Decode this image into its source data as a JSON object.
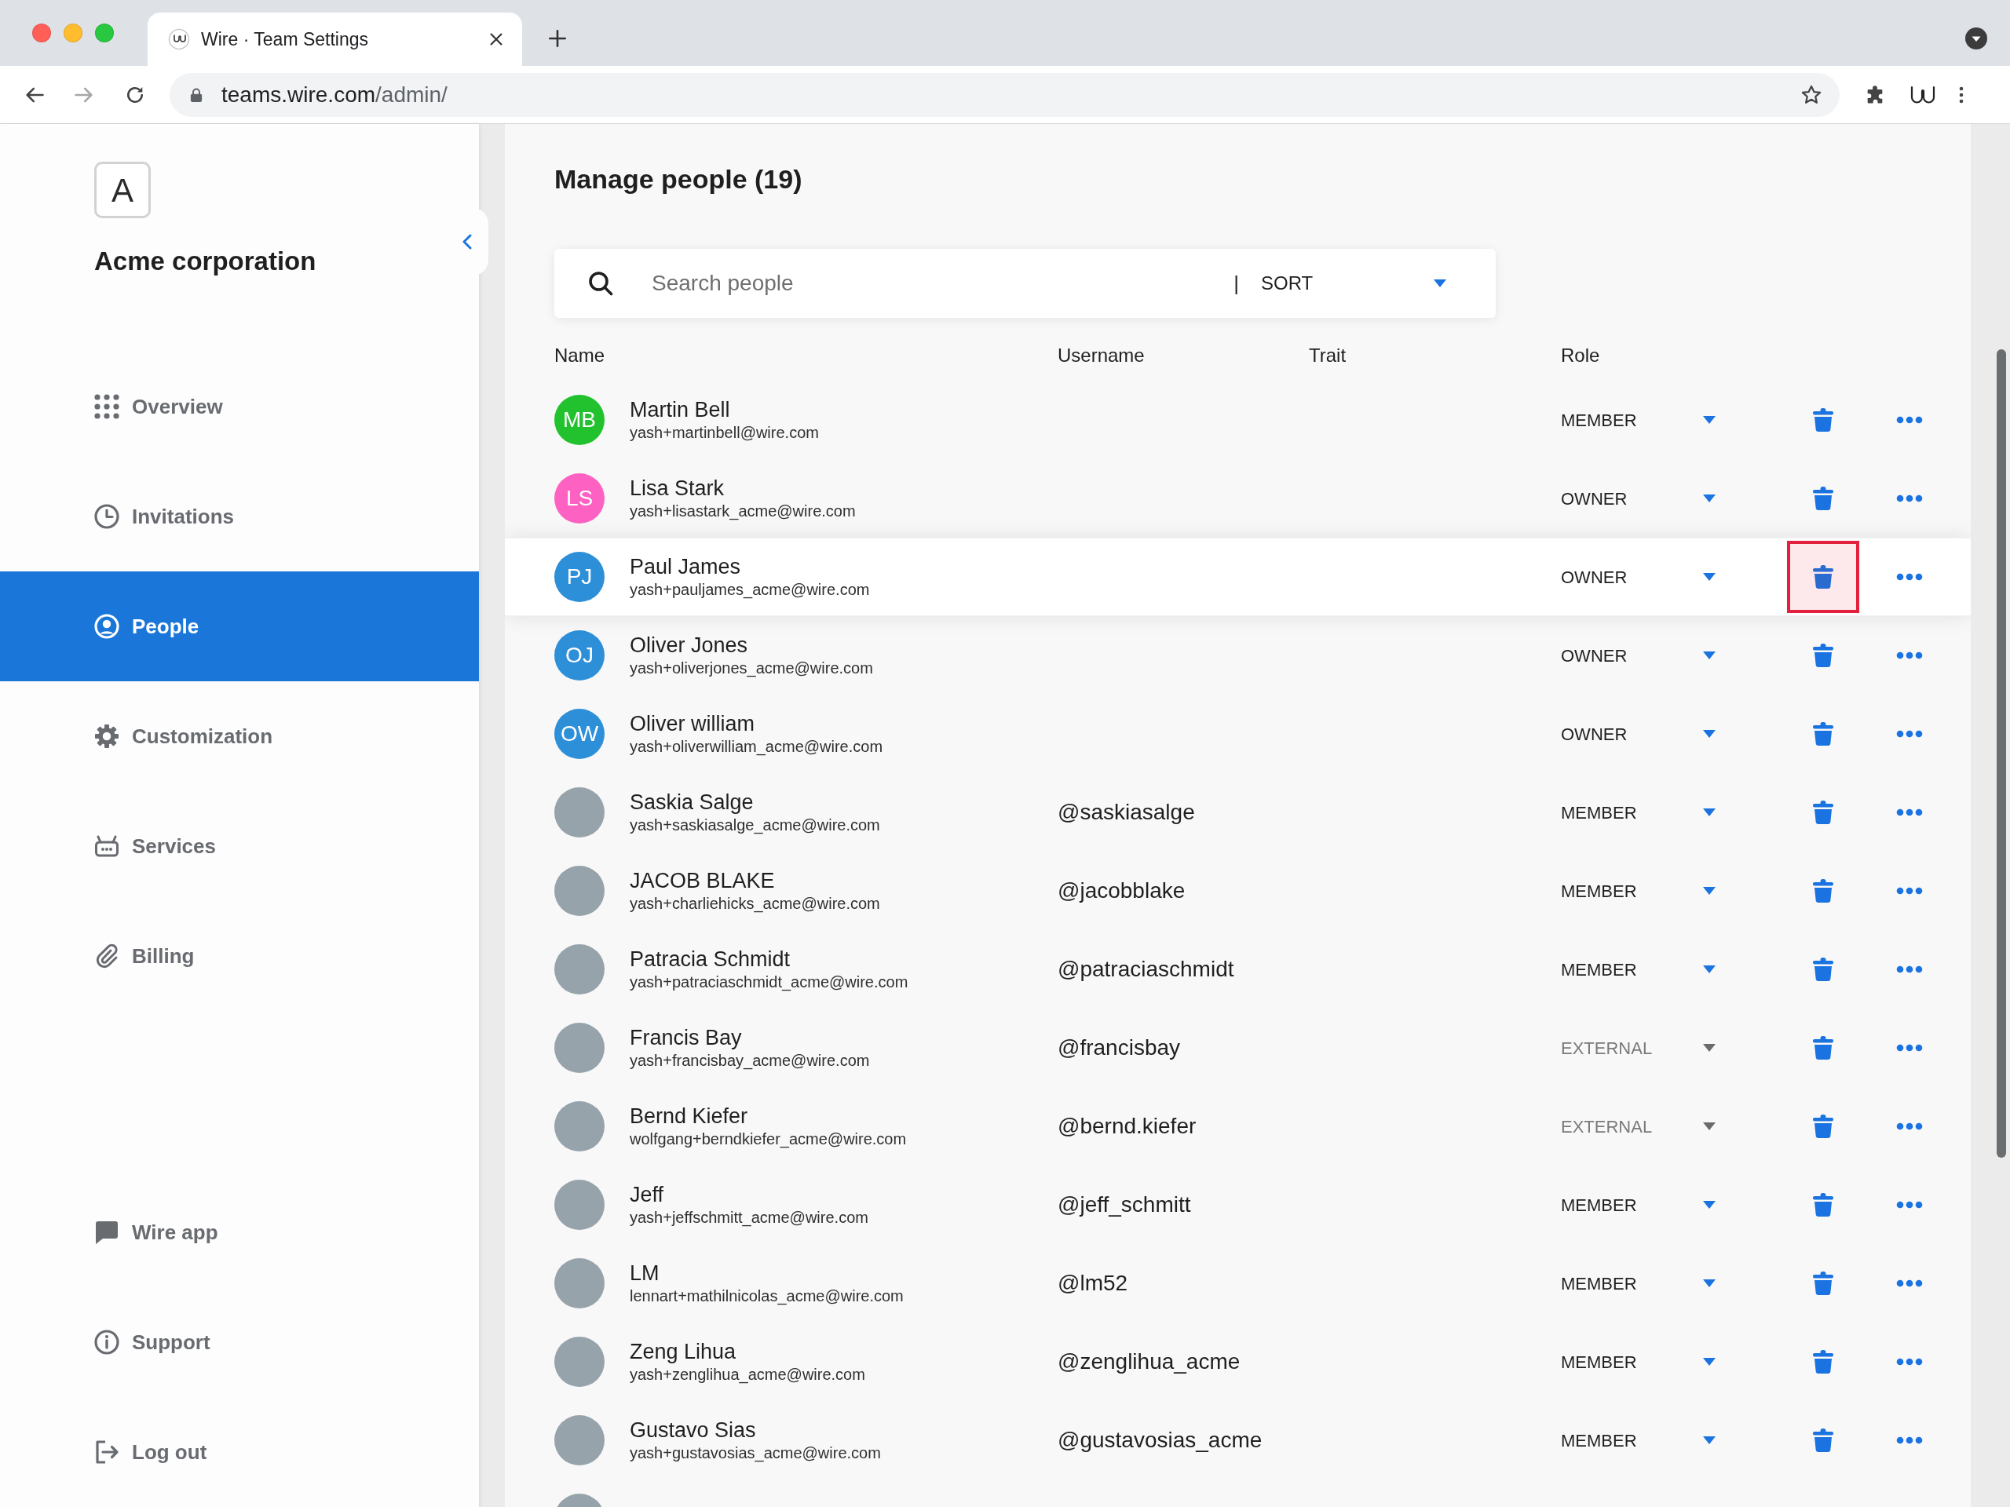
{
  "browser": {
    "tab": {
      "title": "Wire · Team Settings"
    },
    "address": {
      "host": "teams.wire.com",
      "path": "/admin/"
    }
  },
  "sidebar": {
    "logo_letter": "A",
    "team_name": "Acme corporation",
    "items": [
      {
        "label": "Overview",
        "selected": false
      },
      {
        "label": "Invitations",
        "selected": false
      },
      {
        "label": "People",
        "selected": true
      },
      {
        "label": "Customization",
        "selected": false
      },
      {
        "label": "Services",
        "selected": false
      },
      {
        "label": "Billing",
        "selected": false
      }
    ],
    "footer_items": [
      {
        "label": "Wire app"
      },
      {
        "label": "Support"
      },
      {
        "label": "Log out"
      }
    ]
  },
  "main": {
    "title": "Manage people (19)",
    "search": {
      "placeholder": "Search people",
      "separator": "|",
      "sort_label": "SORT"
    },
    "table": {
      "columns": [
        "Name",
        "Username",
        "Trait",
        "Role"
      ],
      "rows": [
        {
          "avatar": {
            "kind": "initials",
            "initials": "MB",
            "color": "#22c22e"
          },
          "name": "Martin Bell",
          "email": "yash+martinbell@wire.com",
          "role": "MEMBER",
          "role_disabled": false,
          "hovered": false,
          "delete_marked": false
        },
        {
          "avatar": {
            "kind": "initials",
            "initials": "LS",
            "color": "#fd62c3"
          },
          "name": "Lisa Stark",
          "email": "yash+lisastark_acme@wire.com",
          "role": "OWNER",
          "role_disabled": false,
          "hovered": false,
          "delete_marked": false
        },
        {
          "avatar": {
            "kind": "initials",
            "initials": "PJ",
            "color": "#2e8fd9"
          },
          "name": "Paul James",
          "email": "yash+pauljames_acme@wire.com",
          "role": "OWNER",
          "role_disabled": false,
          "hovered": true,
          "delete_marked": true
        },
        {
          "avatar": {
            "kind": "initials",
            "initials": "OJ",
            "color": "#2e8fd9"
          },
          "name": "Oliver Jones",
          "email": "yash+oliverjones_acme@wire.com",
          "role": "OWNER",
          "role_disabled": false,
          "hovered": false,
          "delete_marked": false
        },
        {
          "avatar": {
            "kind": "initials",
            "initials": "OW",
            "color": "#2e8fd9"
          },
          "name": "Oliver william",
          "email": "yash+oliverwilliam_acme@wire.com",
          "role": "OWNER",
          "role_disabled": false,
          "hovered": false,
          "delete_marked": false
        },
        {
          "avatar": {
            "kind": "photo"
          },
          "name": "Saskia Salge",
          "email": "yash+saskiasalge_acme@wire.com",
          "username": "@saskiasalge",
          "role": "MEMBER",
          "role_disabled": false,
          "hovered": false,
          "delete_marked": false
        },
        {
          "avatar": {
            "kind": "photo"
          },
          "name": "JACOB BLAKE",
          "email": "yash+charliehicks_acme@wire.com",
          "username": "@jacobblake",
          "role": "MEMBER",
          "role_disabled": false,
          "hovered": false,
          "delete_marked": false
        },
        {
          "avatar": {
            "kind": "photo"
          },
          "name": "Patracia Schmidt",
          "email": "yash+patraciaschmidt_acme@wire.com",
          "username": "@patraciaschmidt",
          "role": "MEMBER",
          "role_disabled": false,
          "hovered": false,
          "delete_marked": false
        },
        {
          "avatar": {
            "kind": "photo"
          },
          "name": "Francis Bay",
          "email": "yash+francisbay_acme@wire.com",
          "username": "@francisbay",
          "role": "EXTERNAL",
          "role_disabled": true,
          "hovered": false,
          "delete_marked": false
        },
        {
          "avatar": {
            "kind": "photo"
          },
          "name": "Bernd Kiefer",
          "email": "wolfgang+berndkiefer_acme@wire.com",
          "username": "@bernd.kiefer",
          "role": "EXTERNAL",
          "role_disabled": true,
          "hovered": false,
          "delete_marked": false
        },
        {
          "avatar": {
            "kind": "photo"
          },
          "name": "Jeff",
          "email": "yash+jeffschmitt_acme@wire.com",
          "username": "@jeff_schmitt",
          "role": "MEMBER",
          "role_disabled": false,
          "hovered": false,
          "delete_marked": false
        },
        {
          "avatar": {
            "kind": "photo"
          },
          "name": "LM",
          "email": "lennart+mathilnicolas_acme@wire.com",
          "username": "@lm52",
          "role": "MEMBER",
          "role_disabled": false,
          "hovered": false,
          "delete_marked": false
        },
        {
          "avatar": {
            "kind": "photo"
          },
          "name": "Zeng Lihua",
          "email": "yash+zenglihua_acme@wire.com",
          "username": "@zenglihua_acme",
          "role": "MEMBER",
          "role_disabled": false,
          "hovered": false,
          "delete_marked": false
        },
        {
          "avatar": {
            "kind": "photo"
          },
          "name": "Gustavo Sias",
          "email": "yash+gustavosias_acme@wire.com",
          "username": "@gustavosias_acme",
          "role": "MEMBER",
          "role_disabled": false,
          "hovered": false,
          "delete_marked": false
        },
        {
          "avatar": {
            "kind": "photo"
          }
        }
      ]
    }
  }
}
